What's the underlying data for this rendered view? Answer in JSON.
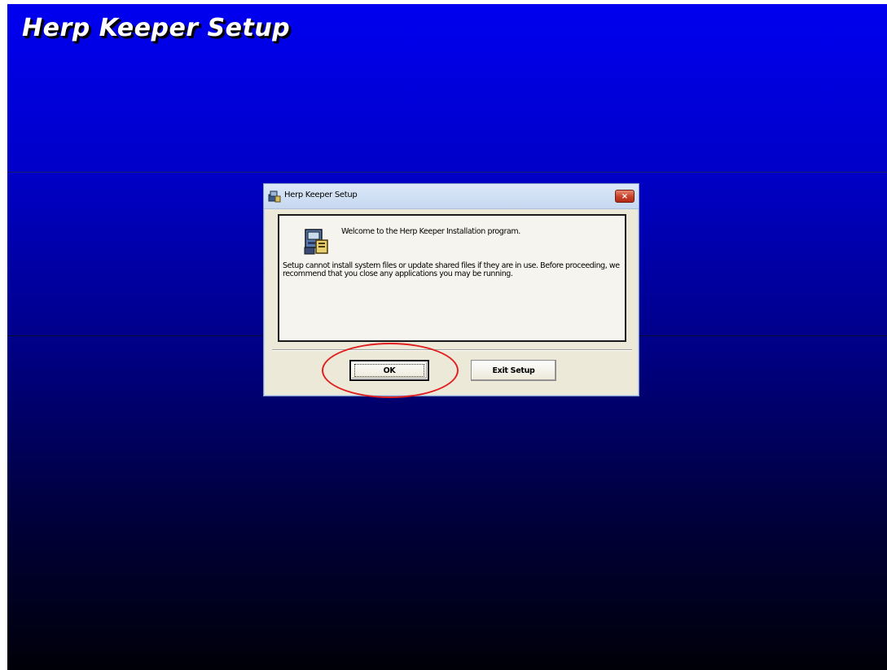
{
  "background": {
    "title": "Herp Keeper Setup"
  },
  "dialog": {
    "title": "Herp Keeper Setup",
    "close_label": "×",
    "welcome": "Welcome to the Herp Keeper Installation program.",
    "message": "Setup cannot install system files or update shared files if they are in use. Before proceeding, we recommend that you close any applications you may be running.",
    "ok_label": "OK",
    "exit_label": "Exit Setup"
  },
  "colors": {
    "background_top": "#0000f0",
    "background_bottom": "#000008",
    "annotation": "#e02020"
  },
  "icons": [
    "setup-icon",
    "close-icon"
  ]
}
